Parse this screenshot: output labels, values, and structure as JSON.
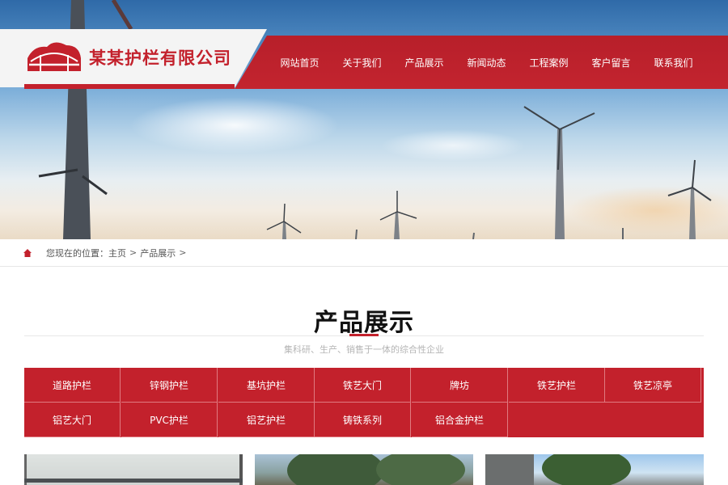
{
  "brand": {
    "company_name": "某某护栏有限公司",
    "accent_color": "#c3212c",
    "logo_icon": "bridge-logo-icon"
  },
  "nav": {
    "items": [
      {
        "label": "网站首页"
      },
      {
        "label": "关于我们"
      },
      {
        "label": "产品展示"
      },
      {
        "label": "新闻动态"
      },
      {
        "label": "工程案例"
      },
      {
        "label": "客户留言"
      },
      {
        "label": "联系我们"
      }
    ]
  },
  "breadcrumb": {
    "icon": "home-icon",
    "prefix": "您现在的位置：",
    "home": "主页",
    "sep1": ">",
    "current": "产品展示",
    "sep2": ">"
  },
  "section": {
    "title": "产品展示",
    "subtitle": "集科研、生产、销售于一体的综合性企业"
  },
  "categories": [
    {
      "label": "道路护栏"
    },
    {
      "label": "锌钢护栏"
    },
    {
      "label": "基坑护栏"
    },
    {
      "label": "铁艺大门"
    },
    {
      "label": "牌坊"
    },
    {
      "label": "铁艺护栏"
    },
    {
      "label": "铁艺凉亭"
    },
    {
      "label": "铝艺大门"
    },
    {
      "label": "PVC护栏"
    },
    {
      "label": "铝艺护栏"
    },
    {
      "label": "铸铁系列"
    },
    {
      "label": "铝合金护栏"
    }
  ]
}
